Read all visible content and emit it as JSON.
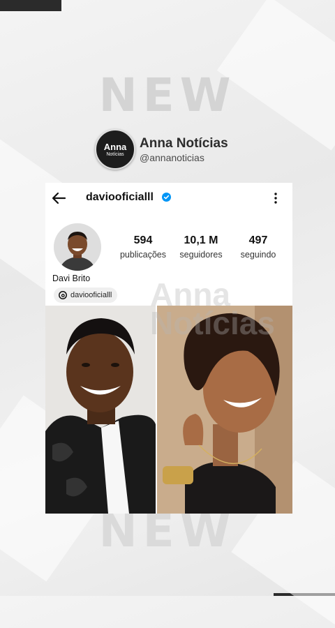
{
  "watermark": {
    "top_text": "NEW",
    "bottom_text": "NEW",
    "overlay_text": "Anna Notícias"
  },
  "brand": {
    "logo_line1": "Anna",
    "logo_line2": "Notícias",
    "name": "Anna Notícias",
    "handle": "@annanoticias"
  },
  "profile": {
    "username": "daviooficialll",
    "verified": true,
    "display_name": "Davi Brito",
    "threads_handle": "daviooficialll",
    "stats": [
      {
        "value": "594",
        "label": "publicações"
      },
      {
        "value": "10,1 M",
        "label": "seguidores"
      },
      {
        "value": "497",
        "label": "seguindo"
      }
    ]
  },
  "icons": {
    "back": "back-arrow-icon",
    "verified": "verified-badge-icon",
    "more": "more-vertical-icon",
    "threads": "threads-icon"
  },
  "colors": {
    "verified_blue": "#0095f6",
    "dark": "#1d1d1d"
  }
}
